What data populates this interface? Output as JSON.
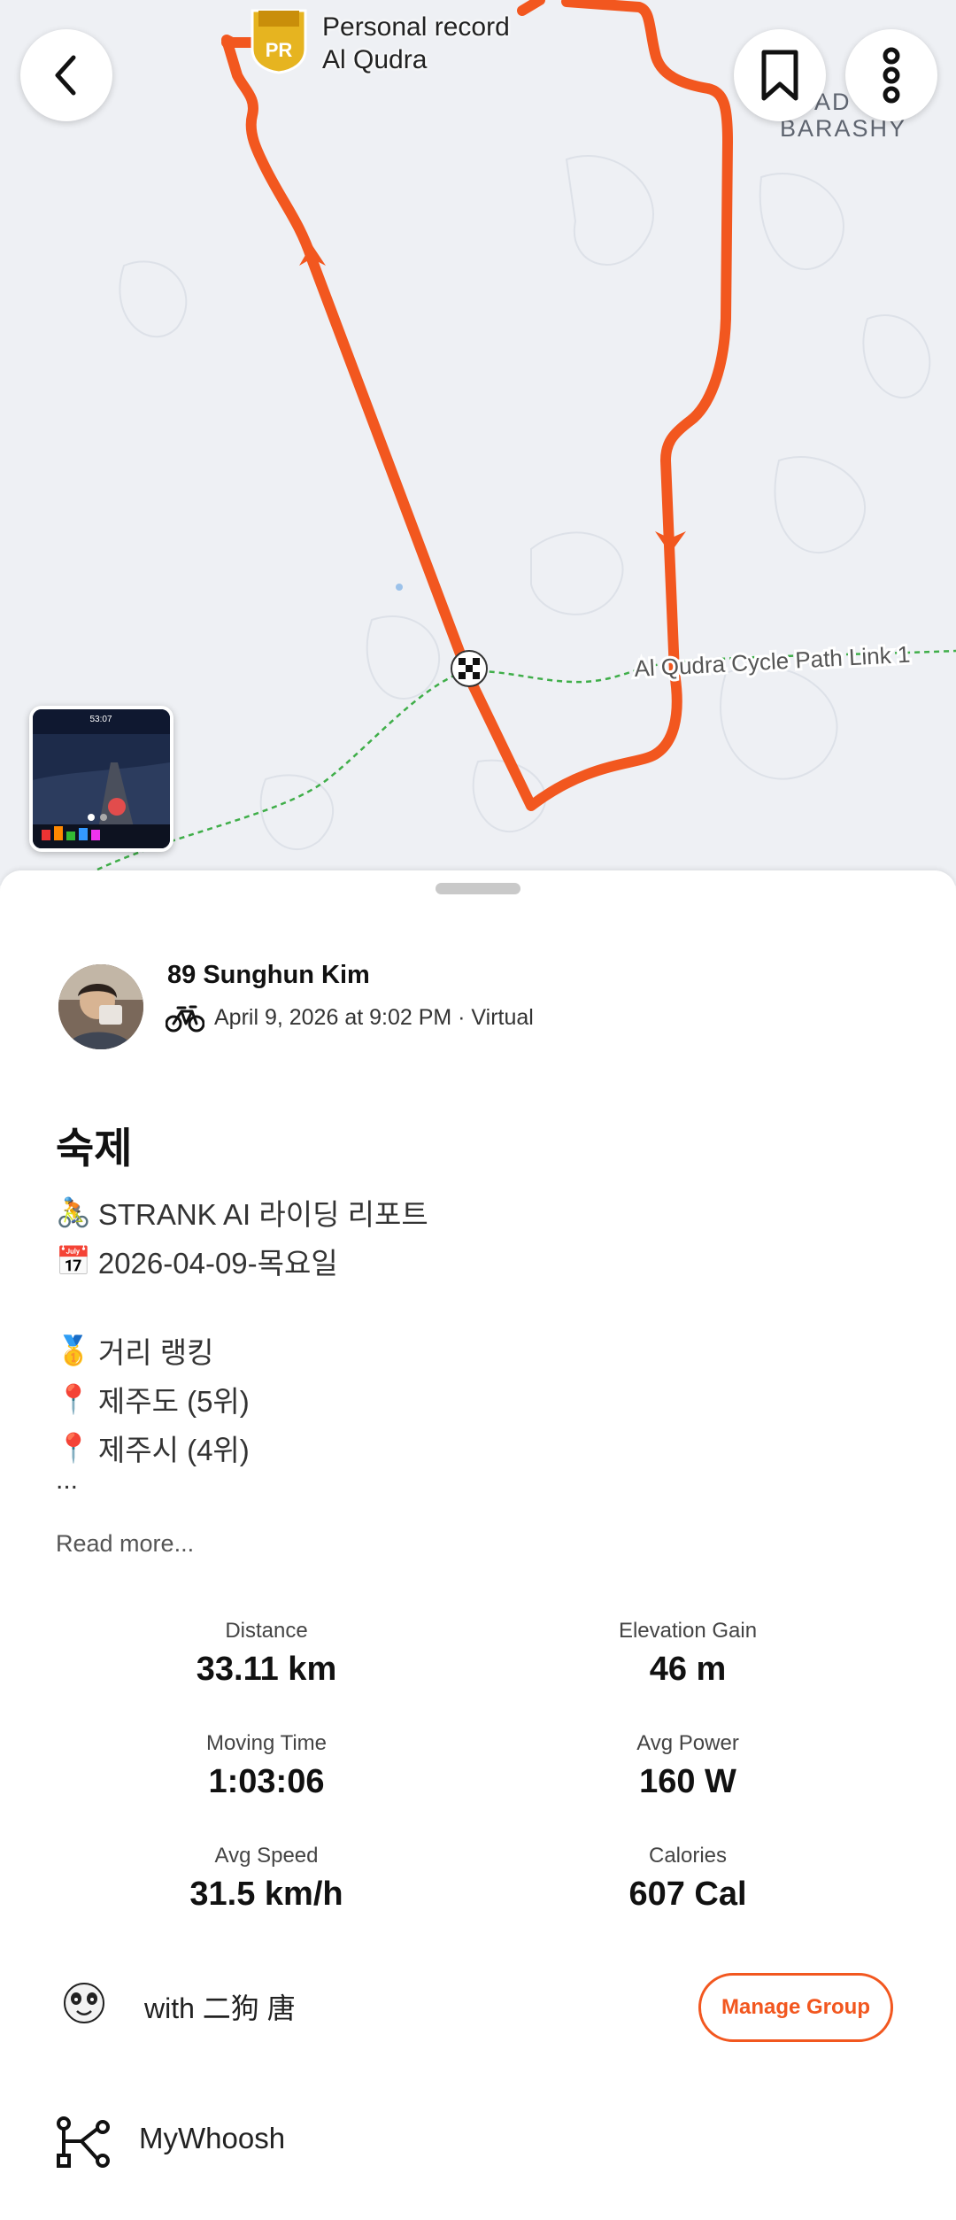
{
  "map": {
    "pr_badge": "PR",
    "pr_label_line1": "Personal record",
    "pr_label_line2": "Al Qudra",
    "area_label_line1": "AD",
    "area_label_line2": "BARASHY",
    "path_label": "Al Qudra Cycle Path Link 1",
    "route_color": "#f2571f",
    "thumbnail_time": "53:07"
  },
  "icons": {
    "back": "chevron-left-icon",
    "bookmark": "bookmark-icon",
    "more": "more-vertical-icon",
    "sport": "bike-icon",
    "device": "device-connection-icon"
  },
  "activity": {
    "athlete_name": "89 Sunghun Kim",
    "meta": "April 9, 2026 at 9:02 PM · Virtual",
    "title": "숙제",
    "description": [
      {
        "emoji": "🚴",
        "text": "STRANK AI 라이딩 리포트"
      },
      {
        "emoji": "📅",
        "text": "2026-04-09-목요일"
      },
      {
        "emoji": "🥇",
        "text": "거리 랭킹"
      },
      {
        "emoji": "📍",
        "text": "제주도 (5위)"
      },
      {
        "emoji": "📍",
        "text": "제주시 (4위)"
      }
    ],
    "ellipsis": "...",
    "read_more": "Read more..."
  },
  "stats": [
    {
      "label": "Distance",
      "value": "33.11 km"
    },
    {
      "label": "Elevation Gain",
      "value": "46 m"
    },
    {
      "label": "Moving Time",
      "value": "1:03:06"
    },
    {
      "label": "Avg Power",
      "value": "160 W"
    },
    {
      "label": "Avg Speed",
      "value": "31.5 km/h"
    },
    {
      "label": "Calories",
      "value": "607 Cal"
    }
  ],
  "group": {
    "text": "with 二狗 唐",
    "manage_label": "Manage Group"
  },
  "device": {
    "name": "MyWhoosh"
  },
  "colors": {
    "accent": "#f2571f"
  }
}
